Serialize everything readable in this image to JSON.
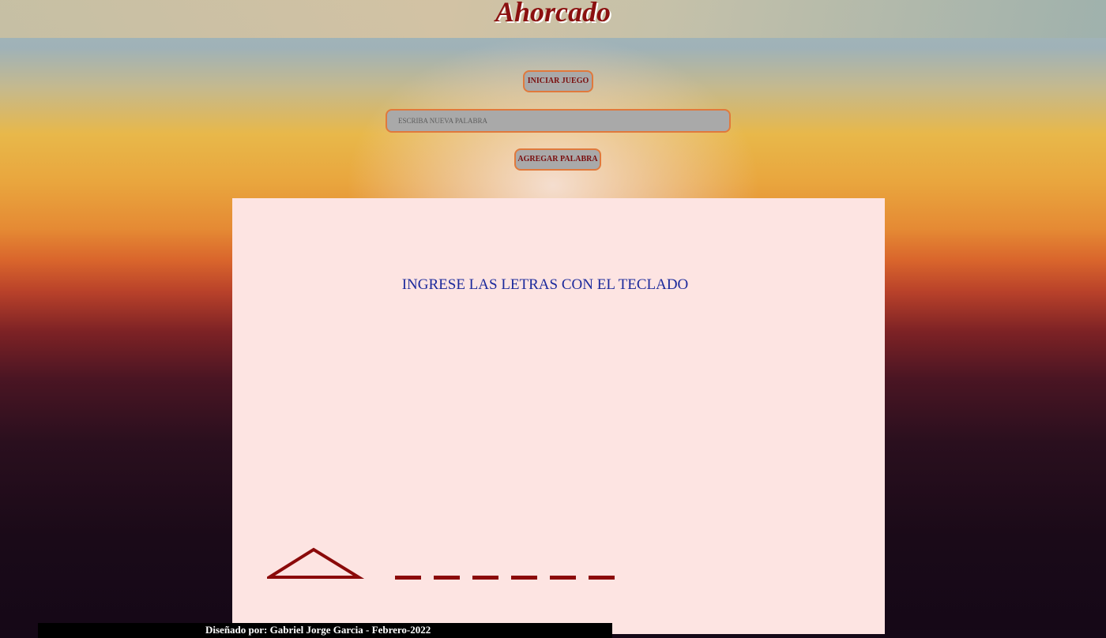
{
  "header": {
    "title": "Ahorcado"
  },
  "controls": {
    "start_button_label": "INICIAR JUEGO",
    "new_word_placeholder": "ESCRIBA NUEVA PALABRA",
    "new_word_value": "",
    "add_word_button_label": "AGREGAR PALABRA"
  },
  "game": {
    "instructions": "INGRESE LAS LETRAS CON EL TECLADO",
    "letter_slot_count": 6,
    "colors": {
      "panel": "#fde4e2",
      "drawing": "#8b0a0a",
      "instructions_text": "#1c2a9c"
    }
  },
  "footer": {
    "credit": "Diseñado por: Gabriel Jorge Garcia - Febrero-2022"
  }
}
